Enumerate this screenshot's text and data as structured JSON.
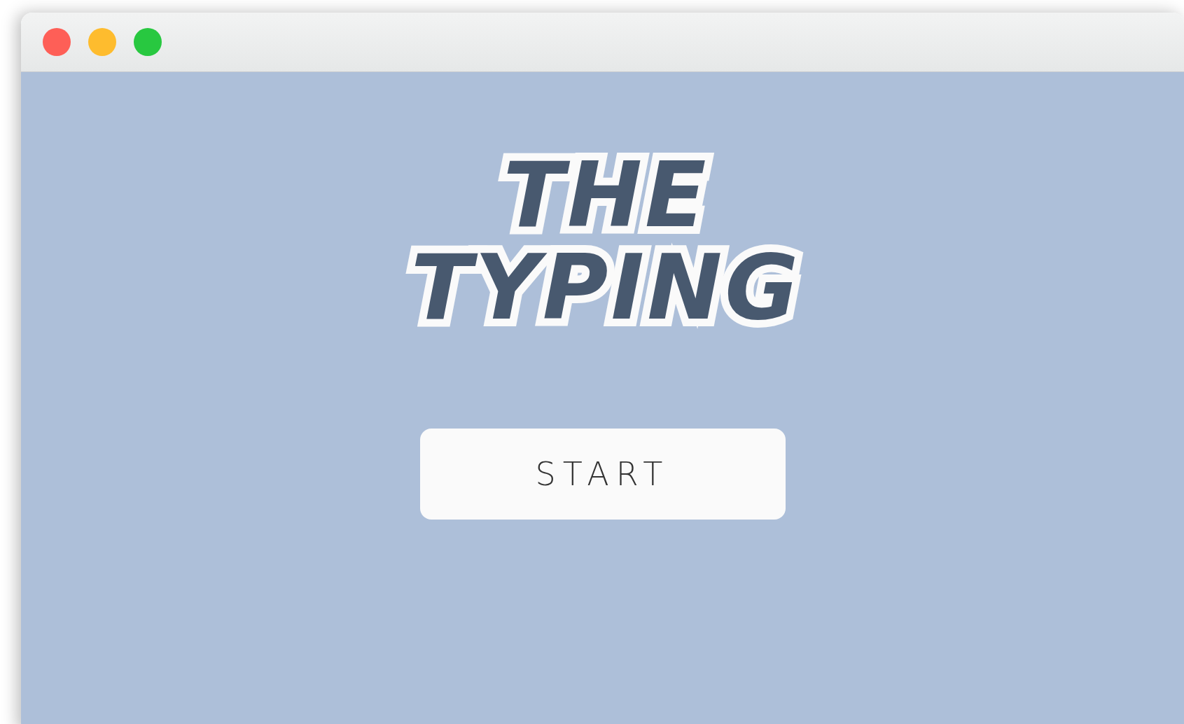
{
  "logo": {
    "lines": [
      "THE",
      "TYPING"
    ]
  },
  "start_button": {
    "label": "START"
  }
}
